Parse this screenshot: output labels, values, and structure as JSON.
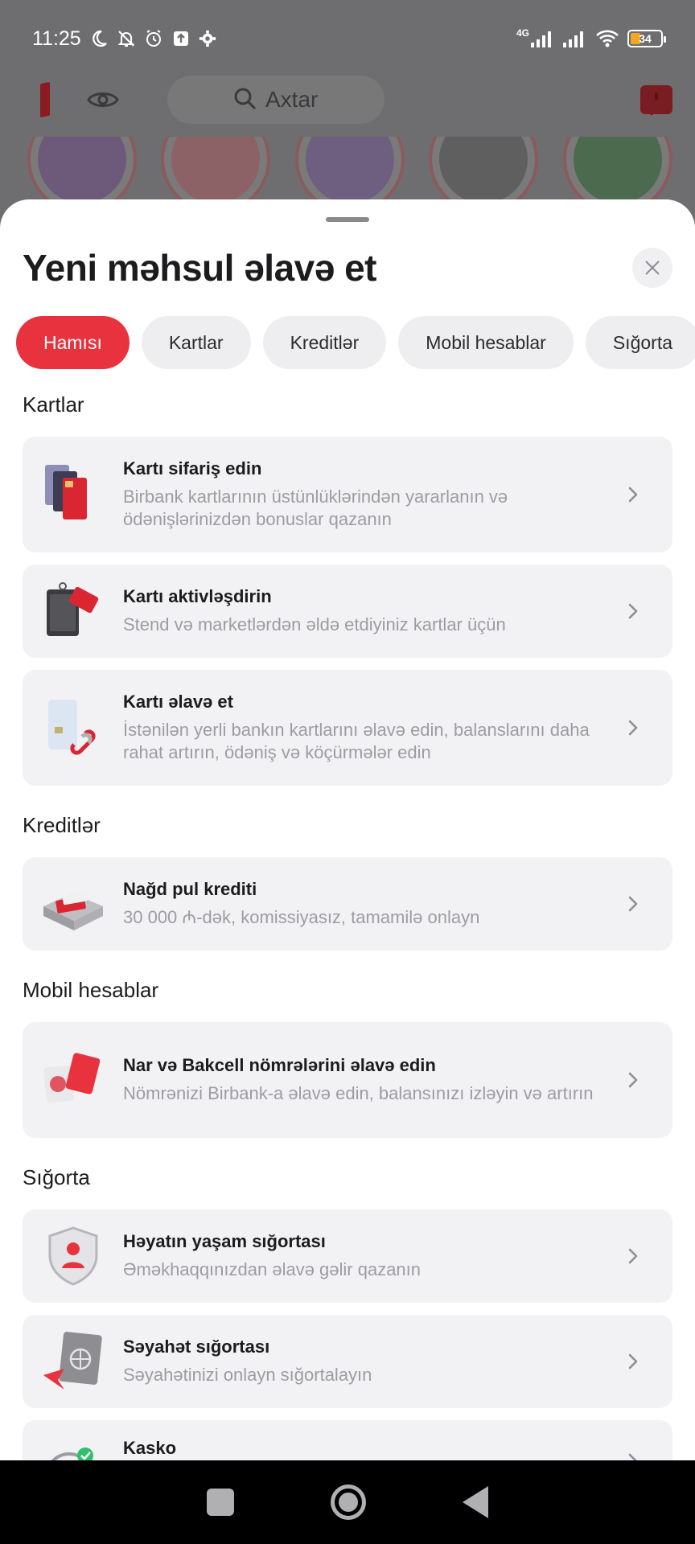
{
  "status_bar": {
    "time": "11:25",
    "network": "4G",
    "battery": "34"
  },
  "app_header": {
    "search_placeholder": "Axtar"
  },
  "sheet": {
    "title": "Yeni məhsul əlavə et",
    "chips": [
      {
        "label": "Hamısı",
        "active": true
      },
      {
        "label": "Kartlar",
        "active": false
      },
      {
        "label": "Kreditlər",
        "active": false
      },
      {
        "label": "Mobil hesablar",
        "active": false
      },
      {
        "label": "Sığorta",
        "active": false
      }
    ],
    "sections": [
      {
        "title": "Kartlar",
        "items": [
          {
            "title": "Kartı sifariş edin",
            "desc": "Birbank kartlarının üstünlüklərindən yararlanın və ödənişlərinizdən bonuslar qazanın",
            "icon": "cards-stack-icon"
          },
          {
            "title": "Kartı aktivləşdirin",
            "desc": "Stend və marketlərdən əldə etdiyiniz kartlar üçün",
            "icon": "card-package-icon"
          },
          {
            "title": "Kartı əlavə et",
            "desc": "İstənilən yerli bankın kartlarını əlavə edin, balanslarını daha rahat artırın, ödəniş və köçürmələr edin",
            "icon": "card-link-icon"
          }
        ]
      },
      {
        "title": "Kreditlər",
        "items": [
          {
            "title": "Nağd pul krediti",
            "desc": "30 000 ₼-dək, komissiyasız, tamamilə onlayn",
            "icon": "cash-box-icon"
          }
        ]
      },
      {
        "title": "Mobil hesablar",
        "items": [
          {
            "title": "Nar və Bakcell nömrələrini əlavə edin",
            "desc": "Nömrənizi Birbank-a əlavə edin, balansınızı izləyin və artırın",
            "icon": "sim-cards-icon"
          }
        ]
      },
      {
        "title": "Sığorta",
        "items": [
          {
            "title": "Həyatın yaşam sığortası",
            "desc": "Əməkhaqqınızdan əlavə gəlir qazanın",
            "icon": "life-insurance-shield-icon"
          },
          {
            "title": "Səyahət sığortası",
            "desc": "Səyahətinizi onlayn sığortalayın",
            "icon": "travel-passport-icon"
          },
          {
            "title": "Kasko",
            "desc": "",
            "icon": "car-insurance-icon"
          }
        ]
      }
    ]
  },
  "colors": {
    "accent": "#e8333f",
    "card_bg": "#f2f2f5",
    "muted_text": "#9c9ca3"
  }
}
